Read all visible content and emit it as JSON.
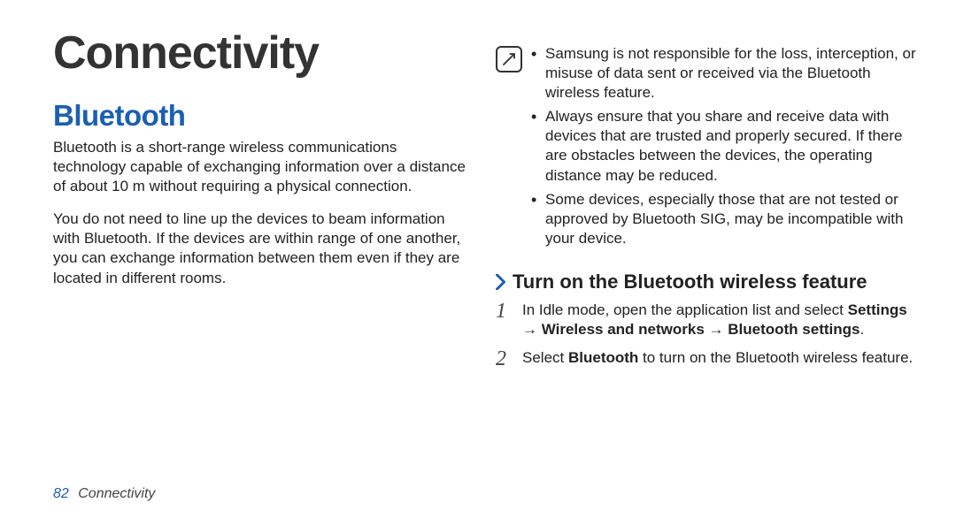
{
  "chapter_title": "Connectivity",
  "section_heading": "Bluetooth",
  "para1": "Bluetooth is a short-range wireless communications technology capable of exchanging information over a distance of about 10 m without requiring a physical connection.",
  "para2": "You do not need to line up the devices to beam information with Bluetooth. If the devices are within range of one another, you can exchange information between them even if they are located in different rooms.",
  "notes": {
    "item1": "Samsung is not responsible for the loss, interception, or misuse of data sent or received via the Bluetooth wireless feature.",
    "item2": "Always ensure that you share and receive data with devices that are trusted and properly secured. If there are obstacles between the devices, the operating distance may be reduced.",
    "item3": "Some devices, especially those that are not tested or approved by Bluetooth SIG, may be incompatible with your device."
  },
  "subsection_title": "Turn on the Bluetooth wireless feature",
  "step1": {
    "num": "1",
    "text_before": "In Idle mode, open the application list and select ",
    "bold": "Settings → Wireless and networks → Bluetooth settings",
    "text_after": "."
  },
  "step2": {
    "num": "2",
    "text_before": "Select ",
    "bold": "Bluetooth",
    "text_after": " to turn on the Bluetooth wireless feature."
  },
  "footer": {
    "page_number": "82",
    "chapter": "Connectivity"
  }
}
